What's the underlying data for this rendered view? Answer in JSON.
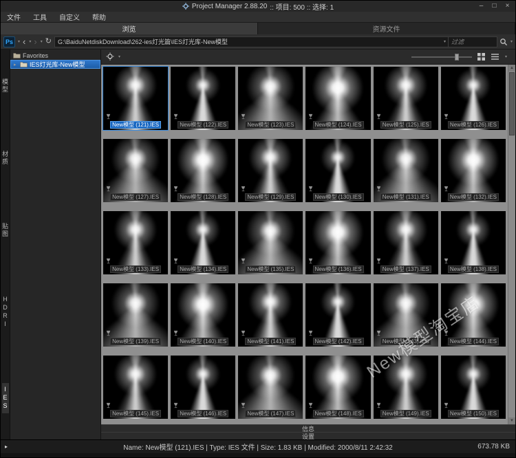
{
  "window": {
    "title": "Project Manager 2.88.20",
    "stats": ":: 项目: 500  :: 选择: 1",
    "minimize": "–",
    "maximize": "□",
    "close": "×"
  },
  "menu": {
    "items": [
      "文件",
      "工具",
      "自定义",
      "帮助"
    ]
  },
  "tabs": {
    "active_index": 0,
    "items": [
      {
        "label": "浏览"
      },
      {
        "label": "资源文件"
      }
    ]
  },
  "toolbar": {
    "ps": "Ps",
    "back": "‹",
    "forward": "›",
    "refresh": "↻",
    "path": "G:\\BaiduNetdiskDownload\\262-ies灯光篇\\IES灯光库-New模型",
    "filter_placeholder": "过滤"
  },
  "categories": {
    "active_index": 4,
    "items": [
      "模型",
      "材质",
      "贴图",
      "HDRI",
      "IES"
    ]
  },
  "tree": {
    "selected_index": 1,
    "items": [
      {
        "label": "Favorites"
      },
      {
        "label": "IES灯光库-New模型"
      }
    ]
  },
  "grid": {
    "items": [
      {
        "name": "New模型 (121).IES",
        "selected": true
      },
      {
        "name": "New模型 (122).IES"
      },
      {
        "name": "New模型 (123).IES"
      },
      {
        "name": "New模型 (124).IES"
      },
      {
        "name": "New模型 (125).IES"
      },
      {
        "name": "New模型 (126).IES"
      },
      {
        "name": "New模型 (127).IES"
      },
      {
        "name": "New模型 (128).IES"
      },
      {
        "name": "New模型 (129).IES"
      },
      {
        "name": "New模型 (130).IES"
      },
      {
        "name": "New模型 (131).IES"
      },
      {
        "name": "New模型 (132).IES"
      },
      {
        "name": "New模型 (133).IES"
      },
      {
        "name": "New模型 (134).IES"
      },
      {
        "name": "New模型 (135).IES"
      },
      {
        "name": "New模型 (136).IES"
      },
      {
        "name": "New模型 (137).IES"
      },
      {
        "name": "New模型 (138).IES"
      },
      {
        "name": "New模型 (139).IES"
      },
      {
        "name": "New模型 (140).IES"
      },
      {
        "name": "New模型 (141).IES"
      },
      {
        "name": "New模型 (142).IES"
      },
      {
        "name": "New模型 (143).IES"
      },
      {
        "name": "New模型 (144).IES"
      },
      {
        "name": "New模型 (145).IES"
      },
      {
        "name": "New模型 (146).IES"
      },
      {
        "name": "New模型 (147).IES"
      },
      {
        "name": "New模型 (148).IES"
      },
      {
        "name": "New模型 (149).IES"
      },
      {
        "name": "New模型 (150).IES"
      }
    ]
  },
  "panels": {
    "info": "信息",
    "settings": "设置"
  },
  "status": {
    "text": "Name: New模型 (121).IES | Type: IES 文件 | Size: 1.83 KB | Modified: 2000/8/11 2:42:32",
    "total_size": "673.78 KB"
  },
  "watermark": "New模型淘宝店",
  "colors": {
    "selection_blue": "#1565c0",
    "tree_selection": "#2f78cd",
    "grid_bg": "#8f8f8f"
  }
}
